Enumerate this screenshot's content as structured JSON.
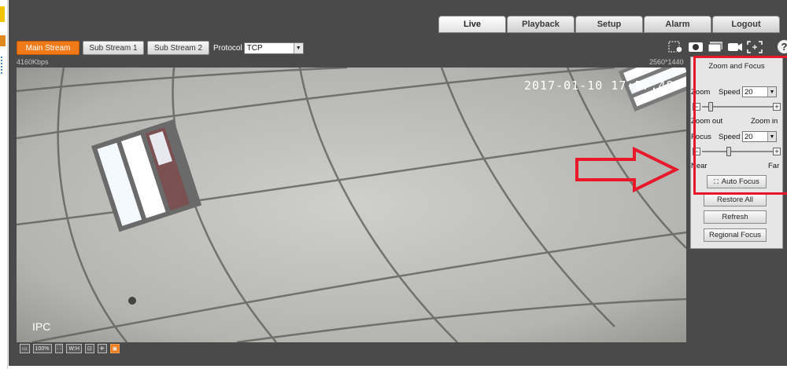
{
  "nav": {
    "tabs": [
      "Live",
      "Playback",
      "Setup",
      "Alarm",
      "Logout"
    ],
    "active": "Live"
  },
  "stream": {
    "main_label": "Main Stream",
    "sub1_label": "Sub Stream 1",
    "sub2_label": "Sub Stream 2",
    "protocol_label": "Protocol",
    "protocol_value": "TCP"
  },
  "toolbar_icons": [
    "zoom-region-icon",
    "snapshot-icon",
    "triple-snapshot-icon",
    "record-icon",
    "fullscreen-icon"
  ],
  "info": {
    "bitrate": "4160Kbps",
    "resolution": "2560*1440"
  },
  "video": {
    "osd_time": "2017-01-10 17:57:48",
    "osd_name": "IPC"
  },
  "video_tools": [
    "▭",
    "100%",
    "⛶",
    "W:H",
    "⊡",
    "⁜",
    "▣"
  ],
  "panel": {
    "title": "Zoom and Focus",
    "zoom_label": "Zoom",
    "zoom_speed_label": "Speed",
    "zoom_speed_value": "20",
    "zoom_out_label": "Zoom out",
    "zoom_in_label": "Zoom in",
    "zoom_level": 0.12,
    "focus_label": "Focus",
    "focus_speed_label": "Speed",
    "focus_speed_value": "20",
    "near_label": "Near",
    "far_label": "Far",
    "focus_level": 0.38,
    "auto_focus_label": "Auto Focus",
    "restore_label": "Restore All",
    "refresh_label": "Refresh",
    "regional_label": "Regional Focus"
  },
  "help_label": "?",
  "colors": {
    "accent": "#f07a18",
    "app_bg": "#4a4a4a",
    "annotation": "#e8182a"
  }
}
